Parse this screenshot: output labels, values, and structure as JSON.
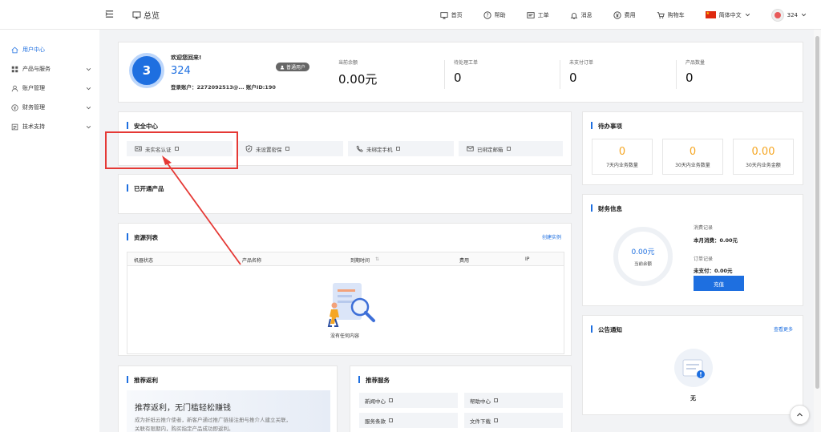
{
  "topbar": {
    "title": "总览",
    "nav": [
      {
        "label": "首页",
        "icon": "monitor-icon"
      },
      {
        "label": "帮助",
        "icon": "help-icon"
      },
      {
        "label": "工单",
        "icon": "ticket-icon"
      },
      {
        "label": "消息",
        "icon": "bell-icon"
      },
      {
        "label": "费用",
        "icon": "yen-icon"
      },
      {
        "label": "购物车",
        "icon": "cart-icon"
      }
    ],
    "language": "简体中文",
    "user": "324"
  },
  "sidebar": {
    "items": [
      {
        "label": "用户中心",
        "icon": "home-icon",
        "active": true
      },
      {
        "label": "产品与服务",
        "icon": "grid-icon"
      },
      {
        "label": "账户管理",
        "icon": "user-icon"
      },
      {
        "label": "财务管理",
        "icon": "yen-icon"
      },
      {
        "label": "技术支持",
        "icon": "doc-icon"
      }
    ]
  },
  "user_card": {
    "level": "3",
    "welcome": "欢迎您回来!",
    "name": "324",
    "account": "登录账户：2272092513@...   账户ID:190",
    "badge": "普通用户",
    "stats": [
      {
        "label": "当前余额",
        "value": "0.00元"
      },
      {
        "label": "待处理工单",
        "value": "0"
      },
      {
        "label": "未支付订单",
        "value": "0"
      },
      {
        "label": "产品数量",
        "value": "0"
      }
    ]
  },
  "security": {
    "title": "安全中心",
    "items": [
      {
        "label": "未实名认证",
        "icon": "id-card-icon"
      },
      {
        "label": "未设置密保",
        "icon": "shield-icon"
      },
      {
        "label": "未绑定手机",
        "icon": "phone-icon"
      },
      {
        "label": "已绑定邮箱",
        "icon": "mail-icon"
      }
    ]
  },
  "products": {
    "title": "已开通产品"
  },
  "resources": {
    "title": "资源列表",
    "create_link": "创建实例",
    "columns": [
      "机器状态",
      "产品名称",
      "到期时间",
      "费用",
      "IP"
    ],
    "empty_text": "没有任何内容"
  },
  "todo": {
    "title": "待办事项",
    "items": [
      {
        "value": "0",
        "label": "7天内业务数量"
      },
      {
        "value": "0",
        "label": "30天内业务数量"
      },
      {
        "value": "0.00",
        "label": "30天内业务金额"
      }
    ]
  },
  "finance": {
    "title": "财务信息",
    "balance": "0.00元",
    "balance_caption": "当前余额",
    "spend_label": "消费记录",
    "spend_value": "本月消费：0.00元",
    "order_label": "订单记录",
    "order_value": "未支付：0.00元",
    "recharge": "充值"
  },
  "notice": {
    "title": "公告通知",
    "more": "查看更多",
    "empty": "无"
  },
  "referral": {
    "title": "推荐返利",
    "headline": "推荐返利，无门槛轻松赚钱",
    "desc": "成为折纸云推介使者，新客户通过推广链接注册与推介人建立关联，关联有限期内，购买指定产品成功即返利。"
  },
  "services": {
    "title": "推荐服务",
    "items": [
      "新闻中心",
      "帮助中心",
      "服务条款",
      "文件下载"
    ]
  },
  "colors": {
    "accent": "#1e6fe0",
    "annotation": "#e53935",
    "warning": "#f5a623"
  }
}
